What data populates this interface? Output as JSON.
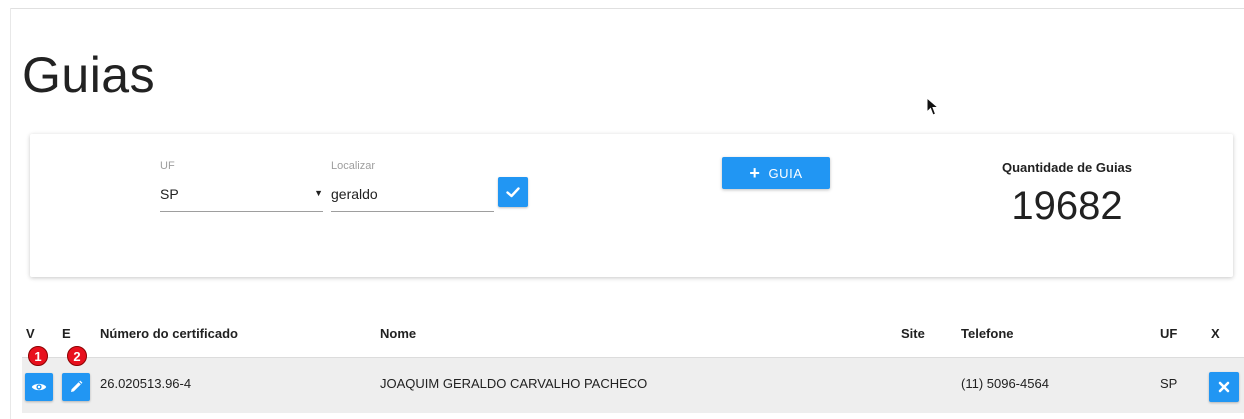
{
  "page": {
    "title": "Guias"
  },
  "filters": {
    "uf_label": "UF",
    "uf_value": "SP",
    "search_label": "Localizar",
    "search_value": "geraldo"
  },
  "actions": {
    "add_guia_label": "GUIA"
  },
  "summary": {
    "label": "Quantidade de Guias",
    "value": "19682"
  },
  "table": {
    "headers": {
      "view": "V",
      "edit": "E",
      "certificate": "Número do certificado",
      "name": "Nome",
      "site": "Site",
      "phone": "Telefone",
      "uf": "UF",
      "delete": "X"
    },
    "rows": [
      {
        "certificate": "26.020513.96-4",
        "name": "JOAQUIM GERALDO CARVALHO PACHECO",
        "site": "",
        "phone": "(11) 5096-4564",
        "uf": "SP"
      }
    ]
  },
  "annotations": {
    "marker_1": "1",
    "marker_2": "2"
  },
  "colors": {
    "accent": "#2196f3",
    "marker": "#e8101d",
    "row_bg": "#eeeeee"
  }
}
